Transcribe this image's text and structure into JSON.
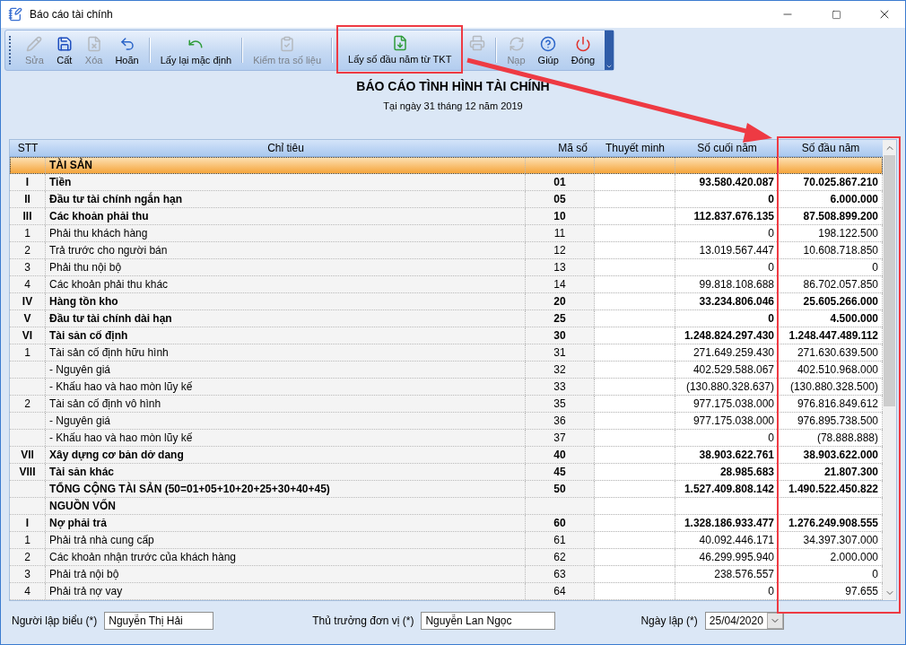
{
  "window": {
    "title": "Báo cáo tài chính"
  },
  "toolbar": {
    "groups": [
      [
        {
          "label": "Sửa",
          "disabled": true
        },
        {
          "label": "Cất",
          "disabled": false
        },
        {
          "label": "Xóa",
          "disabled": true
        },
        {
          "label": "Hoãn",
          "disabled": false
        }
      ],
      [
        {
          "label": "Lấy lại mặc định",
          "disabled": false
        }
      ],
      [
        {
          "label": "Kiểm tra số liệu",
          "disabled": true
        }
      ],
      [
        {
          "label": "Lấy số đầu năm từ TKT",
          "disabled": false
        },
        {
          "disabled": true
        }
      ],
      [
        {
          "label": "Nạp",
          "disabled": true
        },
        {
          "label": "Giúp",
          "disabled": false
        },
        {
          "label": "Đóng",
          "disabled": false
        }
      ]
    ]
  },
  "report": {
    "title": "BÁO CÁO TÌNH HÌNH TÀI CHÍNH",
    "subtitle": "Tại ngày 31 tháng 12 năm 2019"
  },
  "table": {
    "columns": [
      "STT",
      "Chỉ tiêu",
      "Mã số",
      "Thuyết minh",
      "Số cuối năm",
      "Số đầu năm"
    ],
    "rows": [
      {
        "selected": true,
        "bold": true,
        "name": "TÀI SẢN"
      },
      {
        "selected": false,
        "bold": true,
        "stt": "I",
        "name": "Tiền",
        "code": "01",
        "end": "93.580.420.087",
        "start": "70.025.867.210"
      },
      {
        "selected": false,
        "bold": true,
        "stt": "II",
        "name": "Đầu tư tài chính ngắn hạn",
        "code": "05",
        "end": "0",
        "start": "6.000.000"
      },
      {
        "selected": false,
        "bold": true,
        "stt": "III",
        "name": "Các khoản phải thu",
        "code": "10",
        "end": "112.837.676.135",
        "start": "87.508.899.200"
      },
      {
        "selected": false,
        "bold": false,
        "stt": "1",
        "name": "Phải thu khách hàng",
        "code": "11",
        "end": "0",
        "start": "198.122.500"
      },
      {
        "selected": false,
        "bold": false,
        "stt": "2",
        "name": "Trả trước cho người bán",
        "code": "12",
        "end": "13.019.567.447",
        "start": "10.608.718.850"
      },
      {
        "selected": false,
        "bold": false,
        "stt": "3",
        "name": "Phải thu nội bộ",
        "code": "13",
        "end": "0",
        "start": "0"
      },
      {
        "selected": false,
        "bold": false,
        "stt": "4",
        "name": "Các khoản phải thu khác",
        "code": "14",
        "end": "99.818.108.688",
        "start": "86.702.057.850"
      },
      {
        "selected": false,
        "bold": true,
        "stt": "IV",
        "name": "Hàng tồn kho",
        "code": "20",
        "end": "33.234.806.046",
        "start": "25.605.266.000"
      },
      {
        "selected": false,
        "bold": true,
        "stt": "V",
        "name": "Đầu tư tài chính dài hạn",
        "code": "25",
        "end": "0",
        "start": "4.500.000"
      },
      {
        "selected": false,
        "bold": true,
        "stt": "VI",
        "name": "Tài sản cố định",
        "code": "30",
        "end": "1.248.824.297.430",
        "start": "1.248.447.489.112"
      },
      {
        "selected": false,
        "bold": false,
        "stt": "1",
        "name": "Tài sản cố định hữu hình",
        "code": "31",
        "end": "271.649.259.430",
        "start": "271.630.639.500"
      },
      {
        "selected": false,
        "bold": false,
        "name": "- Nguyên giá",
        "code": "32",
        "end": "402.529.588.067",
        "start": "402.510.968.000"
      },
      {
        "selected": false,
        "bold": false,
        "name": "- Khấu hao và hao mòn lũy kế",
        "code": "33",
        "end": "(130.880.328.637)",
        "start": "(130.880.328.500)"
      },
      {
        "selected": false,
        "bold": false,
        "stt": "2",
        "name": "Tài sản cố định vô hình",
        "code": "35",
        "end": "977.175.038.000",
        "start": "976.816.849.612"
      },
      {
        "selected": false,
        "bold": false,
        "name": "- Nguyên giá",
        "code": "36",
        "end": "977.175.038.000",
        "start": "976.895.738.500"
      },
      {
        "selected": false,
        "bold": false,
        "name": "- Khấu hao và hao mòn lũy kế",
        "code": "37",
        "end": "0",
        "start": "(78.888.888)"
      },
      {
        "selected": false,
        "bold": true,
        "stt": "VII",
        "name": "Xây dựng cơ bản dở dang",
        "code": "40",
        "end": "38.903.622.761",
        "start": "38.903.622.000"
      },
      {
        "selected": false,
        "bold": true,
        "stt": "VIII",
        "name": "Tài sản khác",
        "code": "45",
        "end": "28.985.683",
        "start": "21.807.300"
      },
      {
        "selected": false,
        "bold": true,
        "name": "TỔNG CỘNG TÀI SẢN (50=01+05+10+20+25+30+40+45)",
        "code": "50",
        "end": "1.527.409.808.142",
        "start": "1.490.522.450.822"
      },
      {
        "selected": false,
        "bold": true,
        "name": "NGUỒN VỐN"
      },
      {
        "selected": false,
        "bold": true,
        "stt": "I",
        "name": "Nợ phải trả",
        "code": "60",
        "end": "1.328.186.933.477",
        "start": "1.276.249.908.555"
      },
      {
        "selected": false,
        "bold": false,
        "stt": "1",
        "name": "Phải trả nhà cung cấp",
        "code": "61",
        "end": "40.092.446.171",
        "start": "34.397.307.000"
      },
      {
        "selected": false,
        "bold": false,
        "stt": "2",
        "name": "Các khoản nhận trước của khách hàng",
        "code": "62",
        "end": "46.299.995.940",
        "start": "2.000.000"
      },
      {
        "selected": false,
        "bold": false,
        "stt": "3",
        "name": "Phải trả nội bộ",
        "code": "63",
        "end": "238.576.557",
        "start": "0"
      },
      {
        "selected": false,
        "bold": false,
        "stt": "4",
        "name": "Phải trả nợ vay",
        "code": "64",
        "end": "0",
        "start": "97.655"
      }
    ]
  },
  "footer": {
    "fields": [
      {
        "label": "Người lập biểu (*)",
        "value": "Nguyễn Thị Hải"
      },
      {
        "label": "Thủ trưởng đơn vị (*)",
        "value": "Nguyễn Lan Ngọc"
      }
    ],
    "date": {
      "label": "Ngày lập (*)",
      "value": "25/04/2020"
    }
  }
}
